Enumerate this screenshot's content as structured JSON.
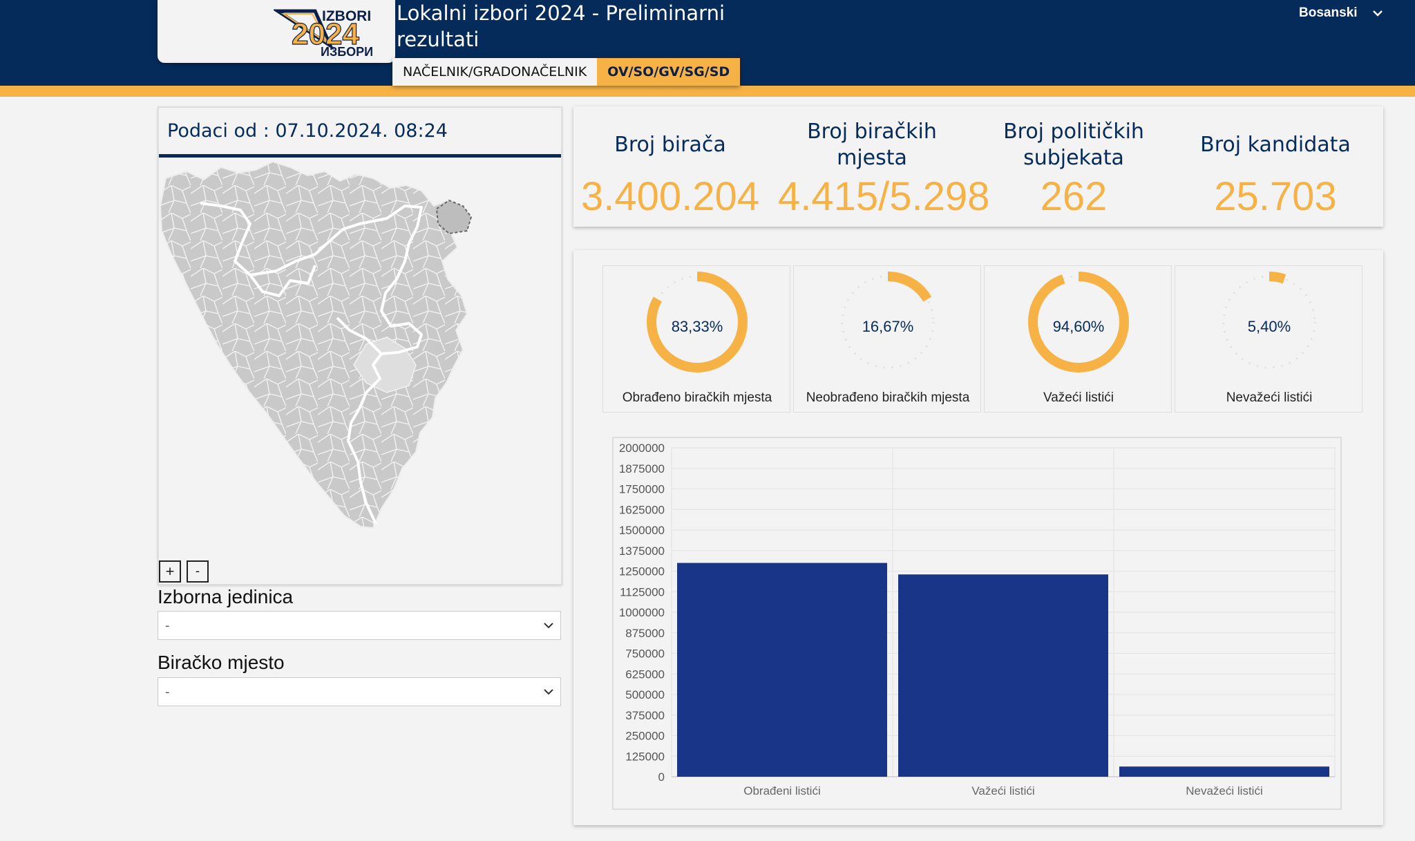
{
  "header": {
    "title": "Lokalni izbori 2024 - Preliminarni rezultati",
    "language": "Bosanski",
    "logo": {
      "line1": "IZBORI",
      "year": "2024",
      "line2": "ИЗБОРИ"
    },
    "tabs": [
      {
        "label": "NAČELNIK/GRADONAČELNIK",
        "active": false
      },
      {
        "label": "OV/SO/GV/SG/SD",
        "active": true
      }
    ]
  },
  "map_panel": {
    "date_text": "Podaci od : 07.10.2024. 08:24",
    "zoom_in": "+",
    "zoom_out": "-"
  },
  "filters": {
    "unit_label": "Izborna jedinica",
    "unit_value": "-",
    "station_label": "Biračko mjesto",
    "station_value": "-"
  },
  "stats": [
    {
      "label": "Broj birača",
      "value": "3.400.204"
    },
    {
      "label": "Broj biračkih mjesta",
      "value": "4.415/5.298"
    },
    {
      "label": "Broj političkih subjekata",
      "value": "262"
    },
    {
      "label": "Broj kandidata",
      "value": "25.703"
    }
  ],
  "donuts": [
    {
      "percent": 83.33,
      "text": "83,33%",
      "label": "Obrađeno biračkih mjesta"
    },
    {
      "percent": 16.67,
      "text": "16,67%",
      "label": "Neobrađeno biračkih mjesta"
    },
    {
      "percent": 94.6,
      "text": "94,60%",
      "label": "Važeći listići"
    },
    {
      "percent": 5.4,
      "text": "5,40%",
      "label": "Nevažeći listići"
    }
  ],
  "colors": {
    "navy": "#052b5b",
    "accent": "#f6b245",
    "bar": "#183587",
    "track": "#e6e6e6"
  },
  "chart_data": {
    "type": "bar",
    "categories": [
      "Obrađeni listići",
      "Važeći listići",
      "Nevažeći listići"
    ],
    "values": [
      1300000,
      1230000,
      62000
    ],
    "ylim": [
      0,
      2000000
    ],
    "yticks": [
      0,
      125000,
      250000,
      375000,
      500000,
      625000,
      750000,
      875000,
      1000000,
      1125000,
      1250000,
      1375000,
      1500000,
      1625000,
      1750000,
      1875000,
      2000000
    ],
    "grid": true
  }
}
